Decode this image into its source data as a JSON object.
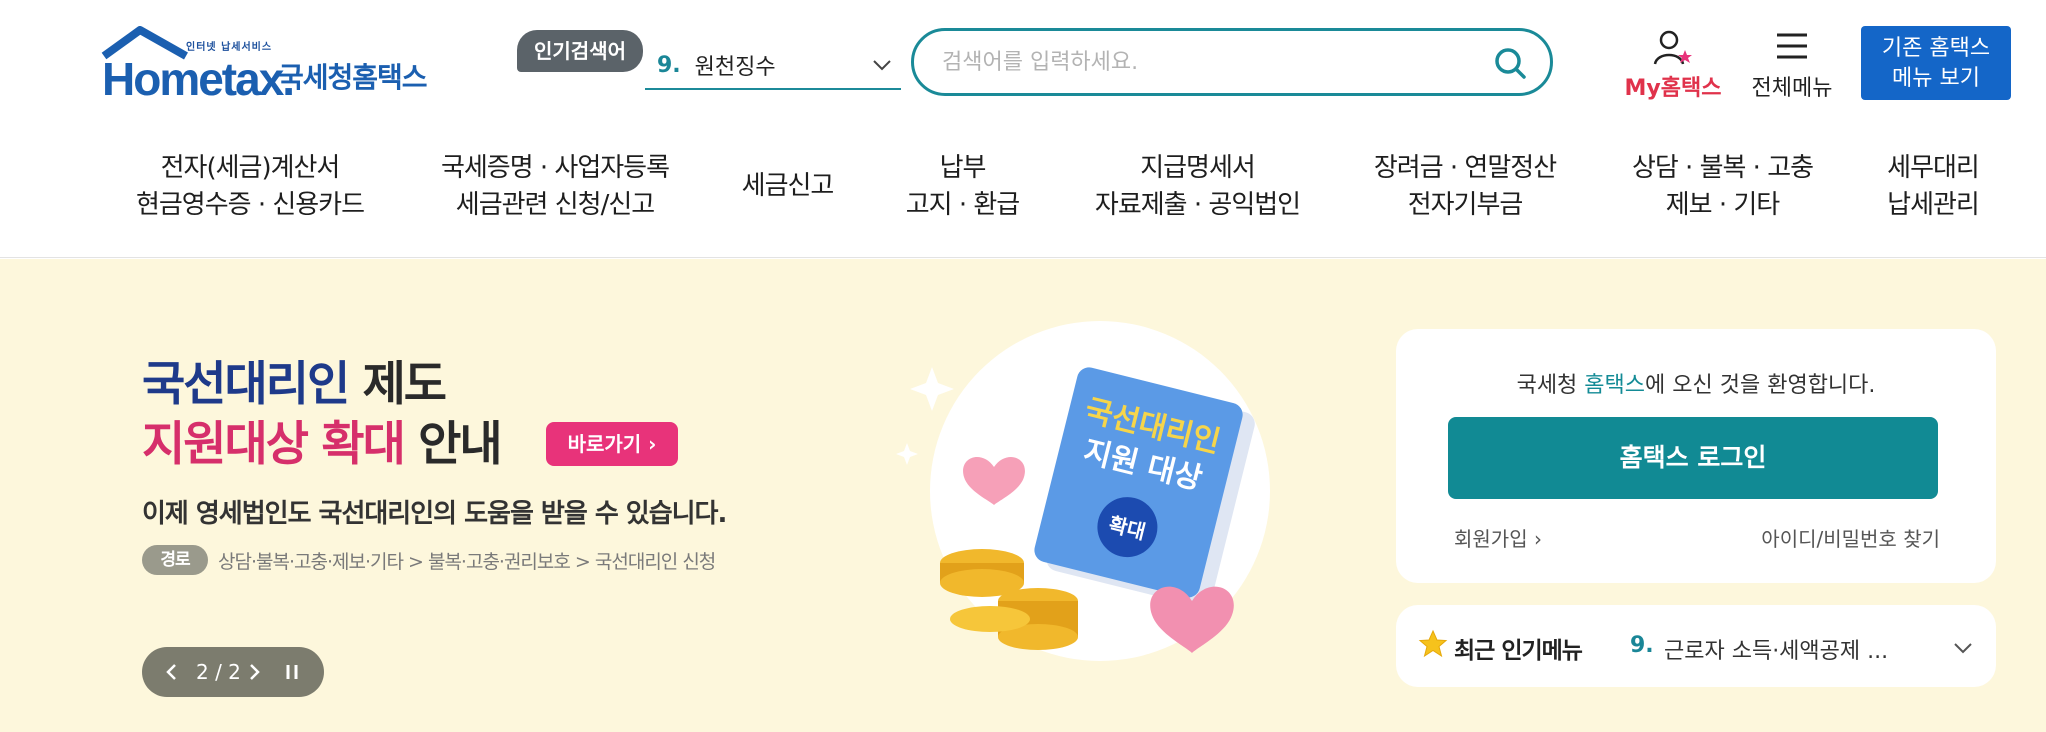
{
  "header": {
    "logo": {
      "small": "인터넷 납세서비스",
      "main": "Hometax.",
      "ko": "국세청홈택스"
    },
    "popular_tag": "인기검색어",
    "popular_num": "9.",
    "popular_value": "원천징수",
    "search_placeholder": "검색어를 입력하세요.",
    "my_label": "My홈택스",
    "allmenu_label": "전체메뉴",
    "oldmenu_line1": "기존 홈택스",
    "oldmenu_line2": "메뉴 보기"
  },
  "gnb": [
    {
      "line1": "전자(세금)계산서",
      "line2": "현금영수증 · 신용카드"
    },
    {
      "line1": "국세증명 · 사업자등록",
      "line2": "세금관련 신청/신고"
    },
    {
      "line1": "세금신고",
      "line2": ""
    },
    {
      "line1": "납부",
      "line2": "고지 · 환급"
    },
    {
      "line1": "지급명세서",
      "line2": "자료제출 · 공익법인"
    },
    {
      "line1": "장려금 · 연말정산",
      "line2": "전자기부금"
    },
    {
      "line1": "상담 · 불복 · 고충",
      "line2": "제보 · 기타"
    },
    {
      "line1": "세무대리",
      "line2": "납세관리"
    }
  ],
  "banner": {
    "title_1a": "국선대리인",
    "title_1b": " 제도",
    "title_2a": "지원대상 확대",
    "title_2b": " 안내",
    "go_label": "바로가기",
    "subtitle": "이제 영세법인도 국선대리인의 도움을 받을 수 있습니다.",
    "path_tag": "경로",
    "path_text": "상담·불복·고충·제보·기타 > 불복·고충·권리보호 > 국선대리인 신청",
    "book_line1": "국선대리인",
    "book_line2": "지원 대상",
    "book_badge": "확대",
    "pager_count": "2 / 2"
  },
  "login": {
    "welcome_pre": "국세청 ",
    "welcome_hl": "홈택스",
    "welcome_post": "에 오신 것을 환영합니다.",
    "login_button": "홈택스 로그인",
    "join": "회원가입",
    "find": "아이디/비밀번호 찾기"
  },
  "recent": {
    "title": "최근 인기메뉴",
    "num": "9.",
    "value": "근로자 소득·세액공제 ..."
  },
  "colors": {
    "brand_blue": "#1b5fb0",
    "teal": "#118a94",
    "pink": "#e8337a",
    "banner_bg": "#fdf7dc"
  }
}
